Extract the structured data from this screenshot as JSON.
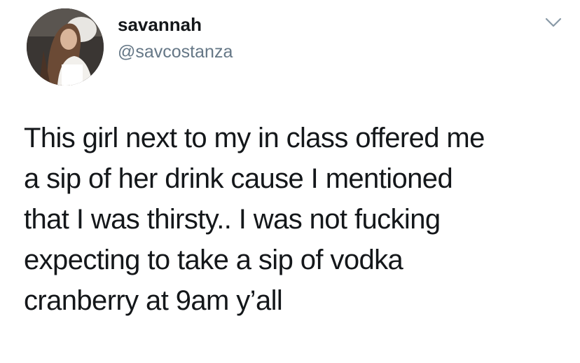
{
  "tweet": {
    "author": {
      "display_name": "savannah",
      "handle": "@savcostanza",
      "avatar_icon": "profile-photo"
    },
    "menu_icon": "chevron-down-icon",
    "text_lines": [
      "This girl next to my in class offered me",
      "a sip of her drink cause I mentioned",
      "that I was thirsty.. I was not fucking",
      "expecting to take a sip of vodka",
      "cranberry at 9am y’all"
    ]
  },
  "colors": {
    "text": "#14171a",
    "handle": "#657786",
    "chevron": "#8899a6",
    "background": "#ffffff"
  }
}
